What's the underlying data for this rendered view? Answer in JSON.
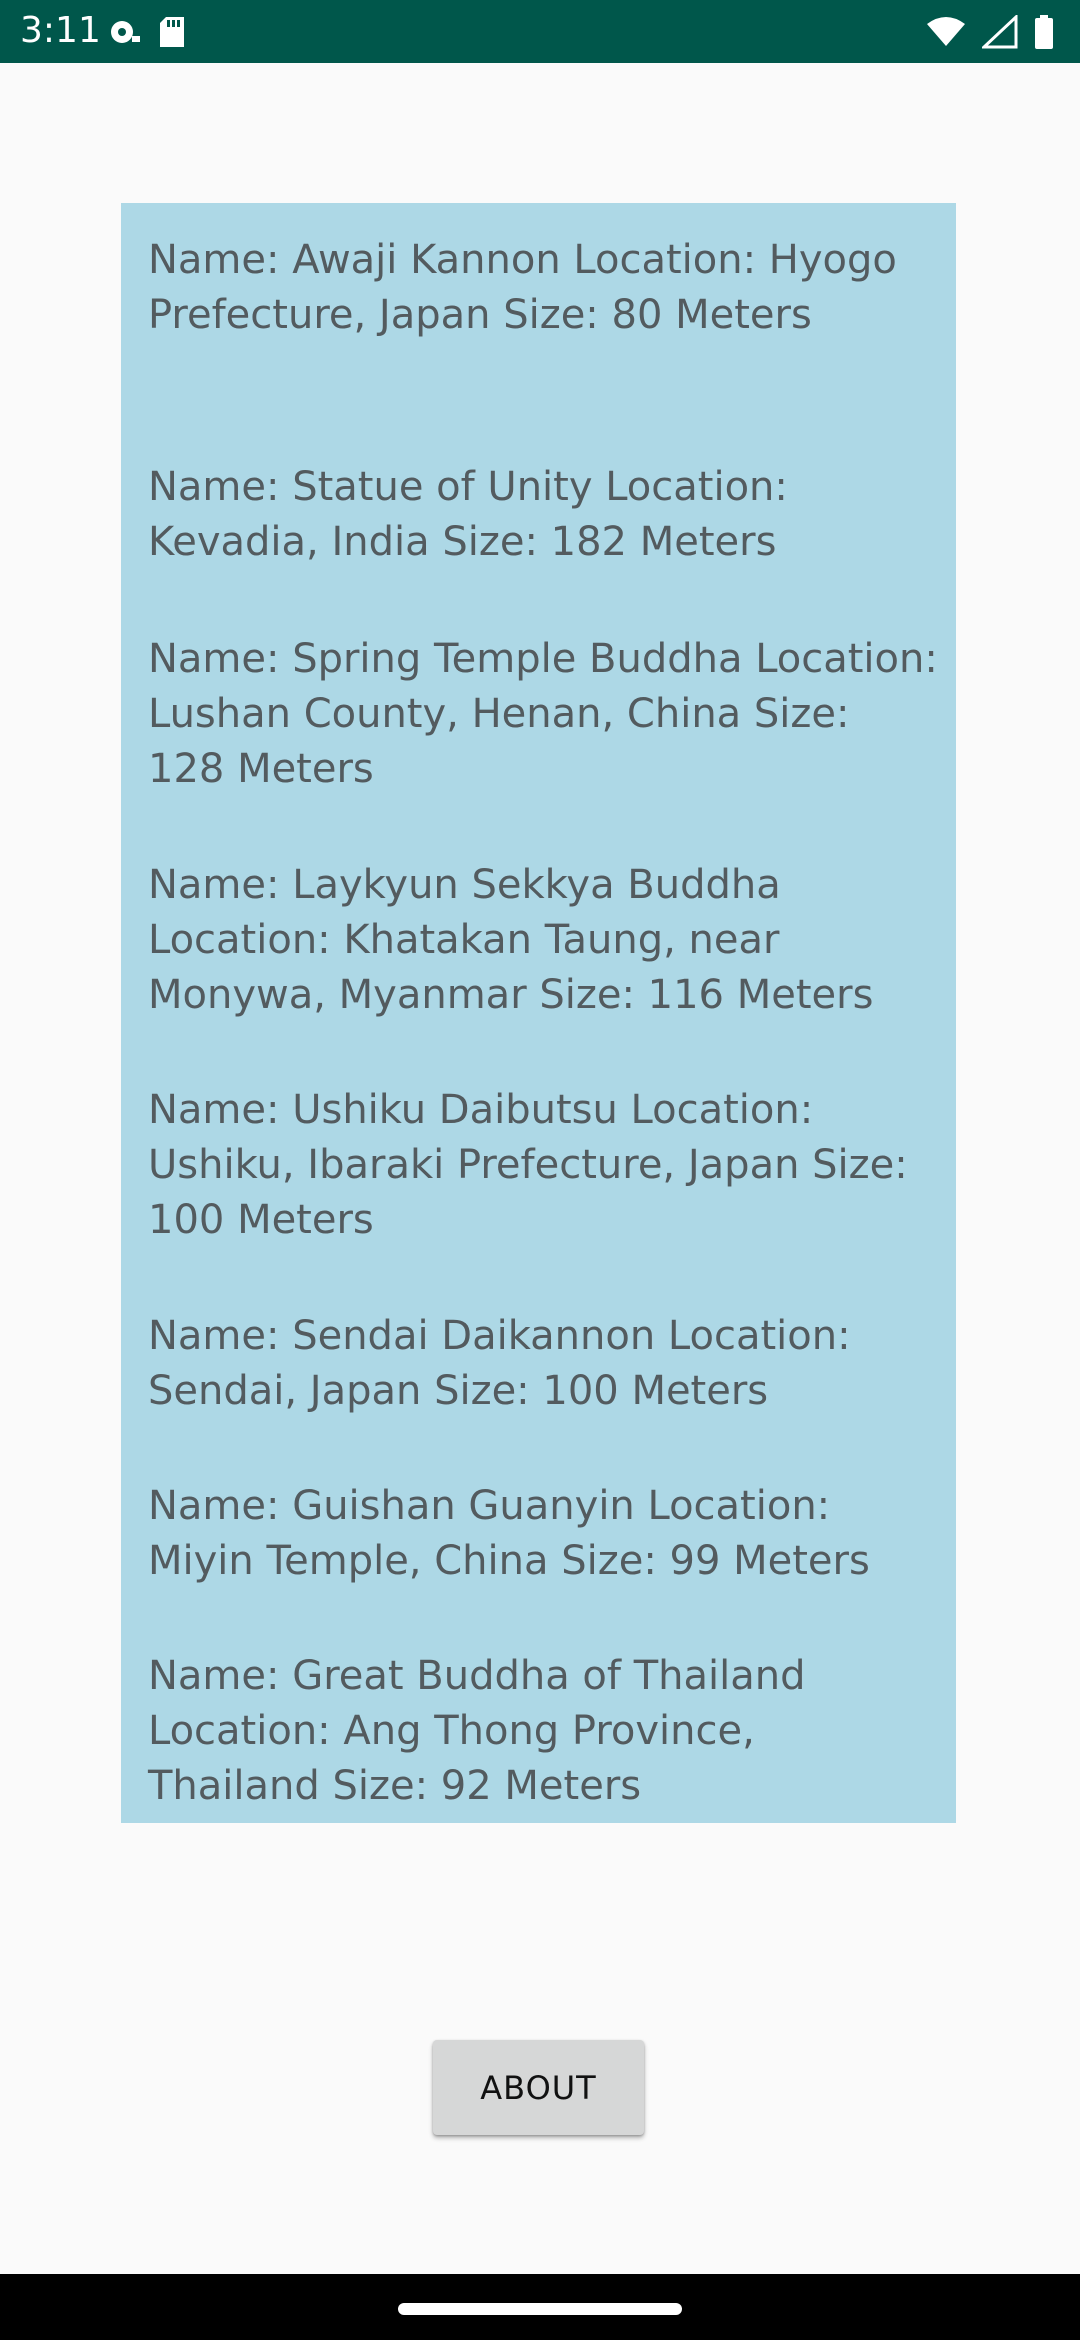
{
  "status_bar": {
    "time": "3:11",
    "background": "#00574B",
    "icons": [
      "media-playing-icon",
      "sd-card-icon",
      "wifi-icon",
      "signal-icon",
      "battery-icon"
    ]
  },
  "statues": [
    {
      "text": "Name: Awaji Kannon Location: Hyogo Prefecture, Japan Size: 80 Meters"
    },
    {
      "text": "Name: Statue of Unity Location: Kevadia, India Size: 182 Meters"
    },
    {
      "text": "Name: Spring Temple Buddha Location: Lushan County, Henan, China Size: 128 Meters"
    },
    {
      "text": "Name: Laykyun Sekkya Buddha Location: Khatakan Taung, near Monywa, Myanmar Size: 116 Meters"
    },
    {
      "text": "Name: Ushiku Daibutsu Location: Ushiku, Ibaraki Prefecture, Japan Size: 100 Meters"
    },
    {
      "text": "Name: Sendai Daikannon Location: Sendai, Japan Size: 100 Meters"
    },
    {
      "text": "Name: Guishan Guanyin Location: Miyin Temple, China Size: 99 Meters"
    },
    {
      "text": "Name: Great Buddha of Thailand Location: Ang Thong Province, Thailand Size: 92 Meters"
    }
  ],
  "panel_color": "#ADD8E6",
  "about_button": {
    "label": "ABOUT"
  }
}
